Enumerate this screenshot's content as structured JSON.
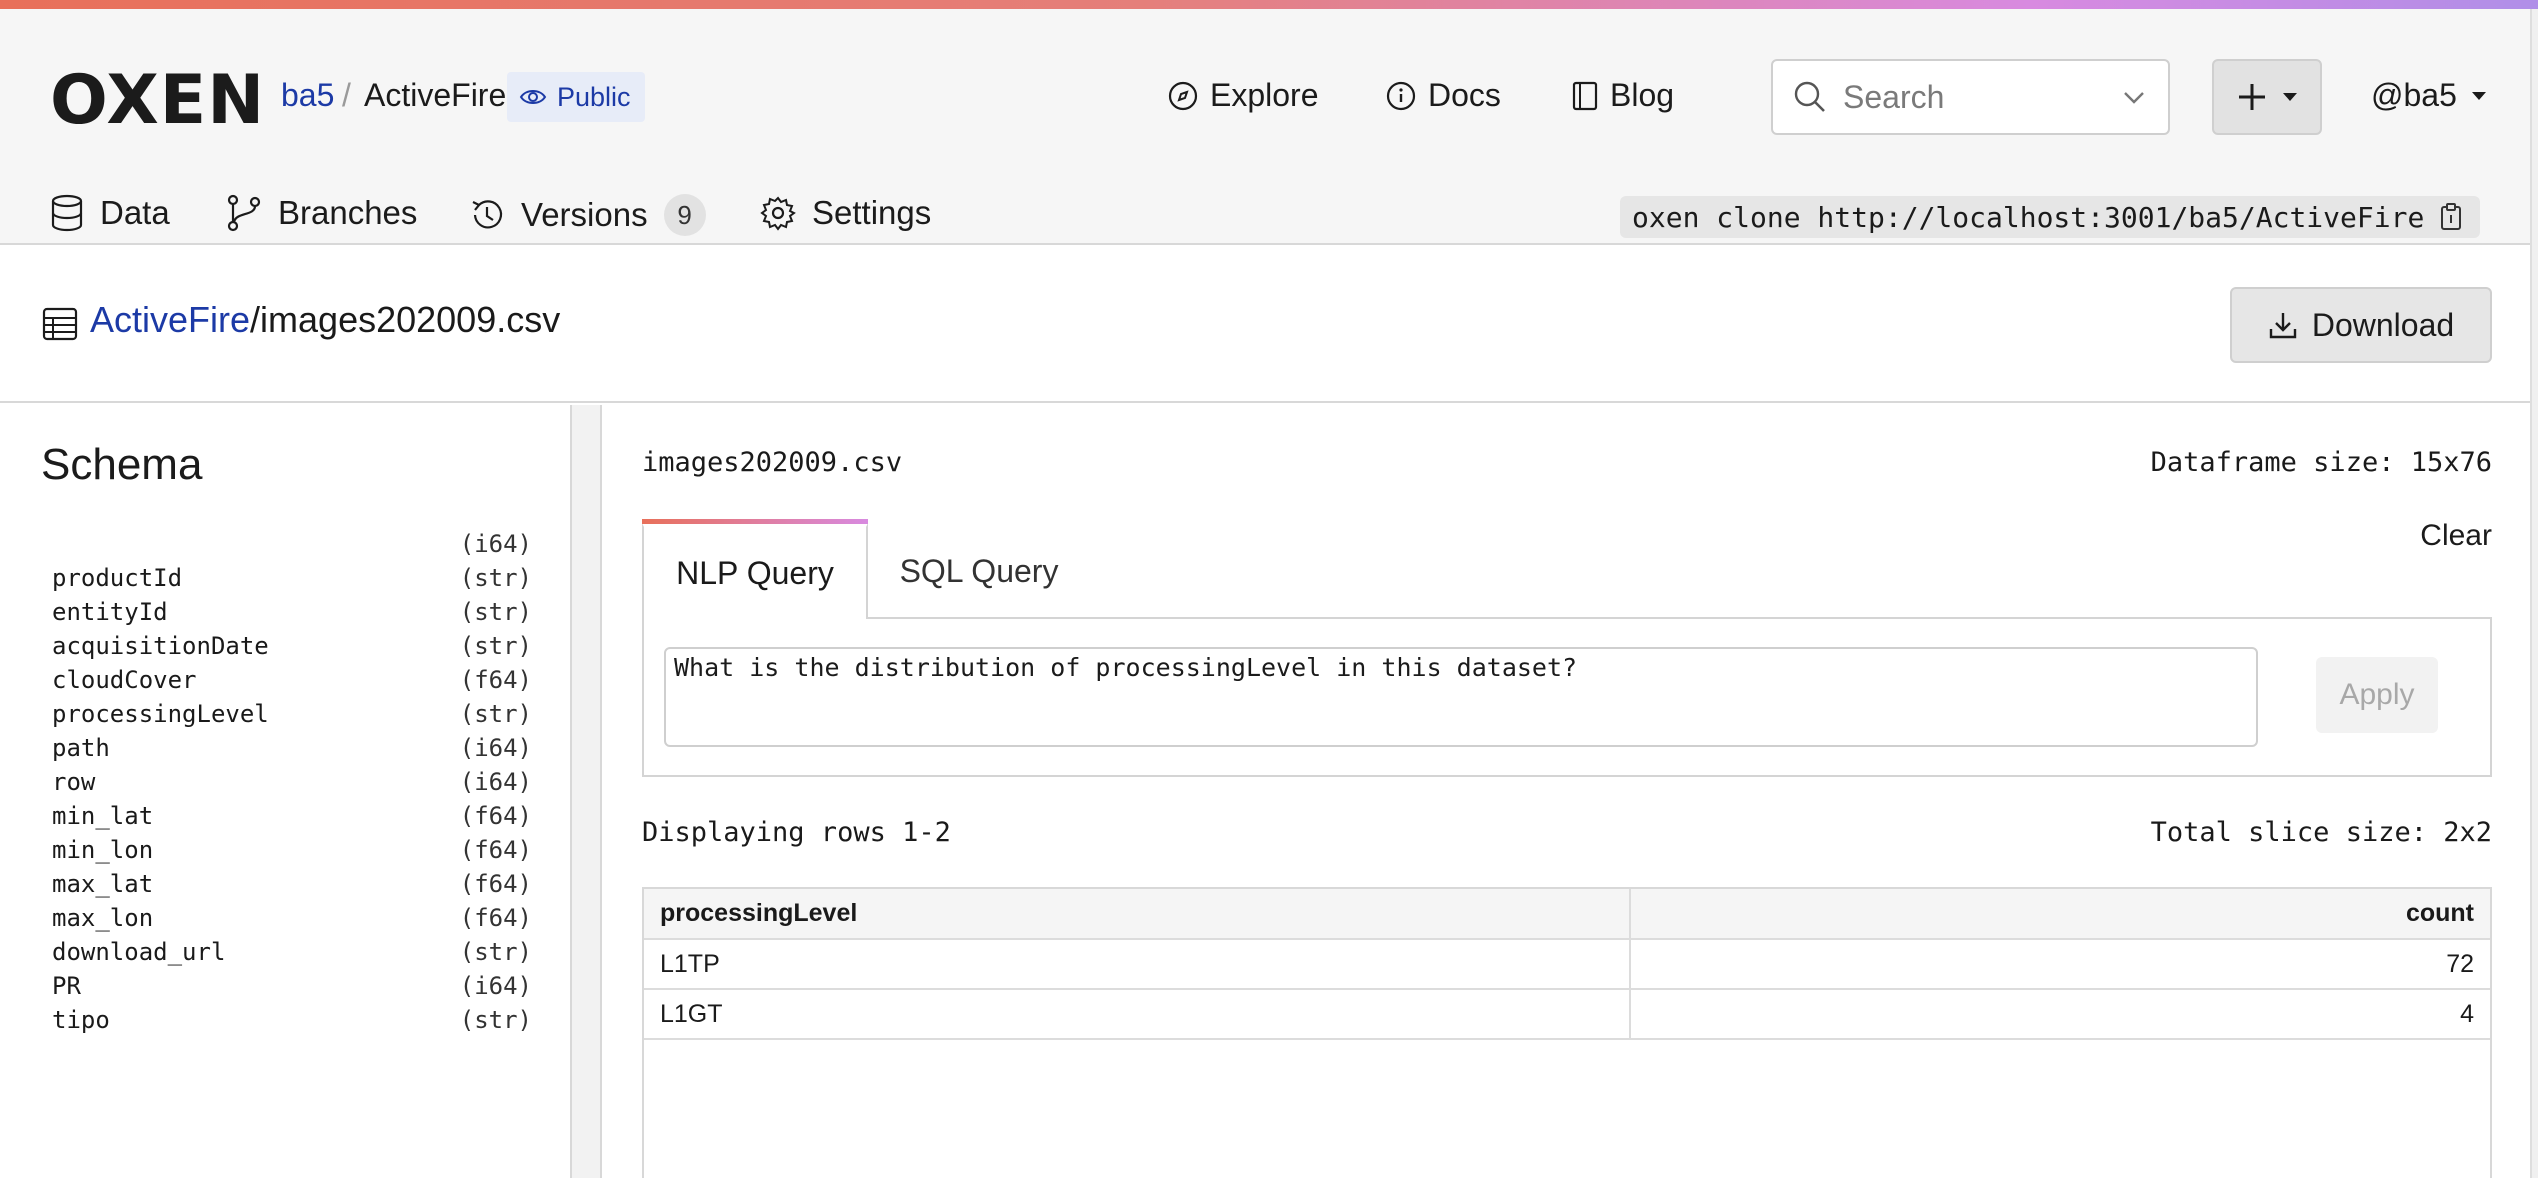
{
  "header": {
    "logo": "OXEN",
    "owner": "ba5",
    "separator": "/",
    "repo": "ActiveFire",
    "visibility": "Public",
    "nav": {
      "explore": "Explore",
      "docs": "Docs",
      "blog": "Blog"
    },
    "search_placeholder": "Search",
    "user": "@ba5"
  },
  "tabs": {
    "data": "Data",
    "branches": "Branches",
    "versions": "Versions",
    "versions_count": "9",
    "settings": "Settings"
  },
  "clone_command": "oxen clone http://localhost:3001/ba5/ActiveFire",
  "path": {
    "repo": "ActiveFire",
    "file": "/images202009.csv",
    "download_label": "Download"
  },
  "schema": {
    "title": "Schema",
    "fields": [
      {
        "name": "",
        "type": "(i64)"
      },
      {
        "name": "productId",
        "type": "(str)"
      },
      {
        "name": "entityId",
        "type": "(str)"
      },
      {
        "name": "acquisitionDate",
        "type": "(str)"
      },
      {
        "name": "cloudCover",
        "type": "(f64)"
      },
      {
        "name": "processingLevel",
        "type": "(str)"
      },
      {
        "name": "path",
        "type": "(i64)"
      },
      {
        "name": "row",
        "type": "(i64)"
      },
      {
        "name": "min_lat",
        "type": "(f64)"
      },
      {
        "name": "min_lon",
        "type": "(f64)"
      },
      {
        "name": "max_lat",
        "type": "(f64)"
      },
      {
        "name": "max_lon",
        "type": "(f64)"
      },
      {
        "name": "download_url",
        "type": "(str)"
      },
      {
        "name": "PR",
        "type": "(i64)"
      },
      {
        "name": "tipo",
        "type": "(str)"
      }
    ]
  },
  "main": {
    "file_name": "images202009.csv",
    "dataframe_size": "Dataframe size: 15x76",
    "query_tabs": {
      "nlp": "NLP Query",
      "sql": "SQL Query"
    },
    "clear_label": "Clear",
    "query_text": "What is the distribution of processingLevel in this dataset?",
    "apply_label": "Apply",
    "rows_info": "Displaying rows 1-2",
    "slice_size": "Total slice size: 2x2",
    "table": {
      "columns": [
        "processingLevel",
        "count"
      ],
      "rows": [
        [
          "L1TP",
          "72"
        ],
        [
          "L1GT",
          "4"
        ]
      ]
    }
  }
}
